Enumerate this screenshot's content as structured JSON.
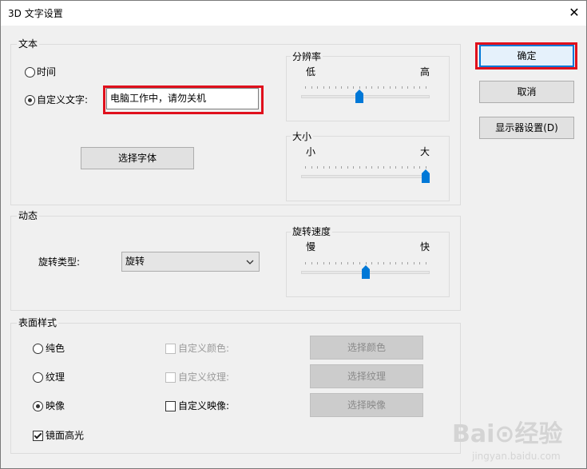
{
  "window": {
    "title": "3D 文字设置",
    "close_glyph": "✕"
  },
  "text_group": {
    "label": "文本",
    "radio_time": "时间",
    "radio_custom": "自定义文字:",
    "custom_text_value": "电脑工作中，请勿关机",
    "choose_font": "选择字体",
    "resolution": {
      "label": "分辨率",
      "min": "低",
      "max": "高",
      "level": 0.45
    },
    "size": {
      "label": "大小",
      "min": "小",
      "max": "大",
      "level": 1.0
    }
  },
  "motion_group": {
    "label": "动态",
    "rotation_type_label": "旋转类型:",
    "rotation_type_value": "旋转",
    "speed": {
      "label": "旋转速度",
      "min": "慢",
      "max": "快",
      "level": 0.5
    }
  },
  "surface_group": {
    "label": "表面样式",
    "solid": "纯色",
    "texture": "纹理",
    "reflection": "映像",
    "custom_color": "自定义颜色:",
    "custom_texture": "自定义纹理:",
    "custom_reflection": "自定义映像:",
    "choose_color": "选择颜色",
    "choose_texture": "选择纹理",
    "choose_reflection": "选择映像",
    "specular": "镜面高光"
  },
  "buttons": {
    "ok": "确定",
    "cancel": "取消",
    "display_settings": "显示器设置(D)"
  },
  "watermark": {
    "logo": "Bai⊙经验",
    "url": "jingyan.baidu.com"
  },
  "colors": {
    "accent": "#0078d7",
    "highlight": "#e0101c"
  }
}
